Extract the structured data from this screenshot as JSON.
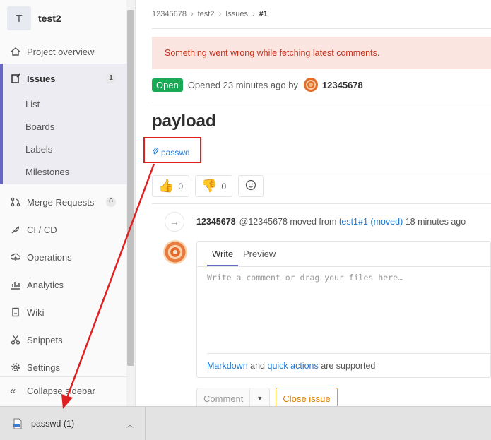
{
  "project": {
    "initial": "T",
    "name": "test2"
  },
  "sidebar": {
    "items": [
      {
        "label": "Project overview",
        "icon": "home-icon"
      },
      {
        "label": "Issues",
        "icon": "issues-icon",
        "count": "1"
      },
      {
        "label": "Merge Requests",
        "icon": "merge-request-icon",
        "count": "0"
      },
      {
        "label": "CI / CD",
        "icon": "rocket-icon"
      },
      {
        "label": "Operations",
        "icon": "cloud-icon"
      },
      {
        "label": "Analytics",
        "icon": "chart-icon"
      },
      {
        "label": "Wiki",
        "icon": "book-icon"
      },
      {
        "label": "Snippets",
        "icon": "scissors-icon"
      },
      {
        "label": "Settings",
        "icon": "gear-icon"
      }
    ],
    "issues_sub": [
      "List",
      "Boards",
      "Labels",
      "Milestones"
    ],
    "collapse_label": "Collapse sidebar"
  },
  "breadcrumb": [
    "12345678",
    "test2",
    "Issues",
    "#1"
  ],
  "alert": {
    "text": "Something went wrong while fetching latest comments."
  },
  "issue": {
    "status": "Open",
    "opened_text": "Opened 23 minutes ago by",
    "author": "12345678",
    "title": "payload",
    "attachment": "passwd"
  },
  "reactions": [
    {
      "emoji": "thumbs-up",
      "count": "0"
    },
    {
      "emoji": "thumbs-down",
      "count": "0"
    }
  ],
  "system_note": {
    "author": "12345678",
    "handle": "@12345678",
    "text_before": "moved from",
    "link": "test1#1",
    "link_suffix": "(moved)",
    "time": "18 minutes ago"
  },
  "comment_form": {
    "tab_write": "Write",
    "tab_preview": "Preview",
    "placeholder": "Write a comment or drag your files here…",
    "markdown": "Markdown",
    "and": "and",
    "quick_actions": "quick actions",
    "supported": "are supported",
    "comment_button": "Comment",
    "close_button": "Close issue"
  },
  "download": {
    "filename": "passwd (1)"
  },
  "colors": {
    "accent": "#6666c4",
    "open": "#1aaa55",
    "link": "#1f78d1",
    "annotation": "#e02020"
  }
}
